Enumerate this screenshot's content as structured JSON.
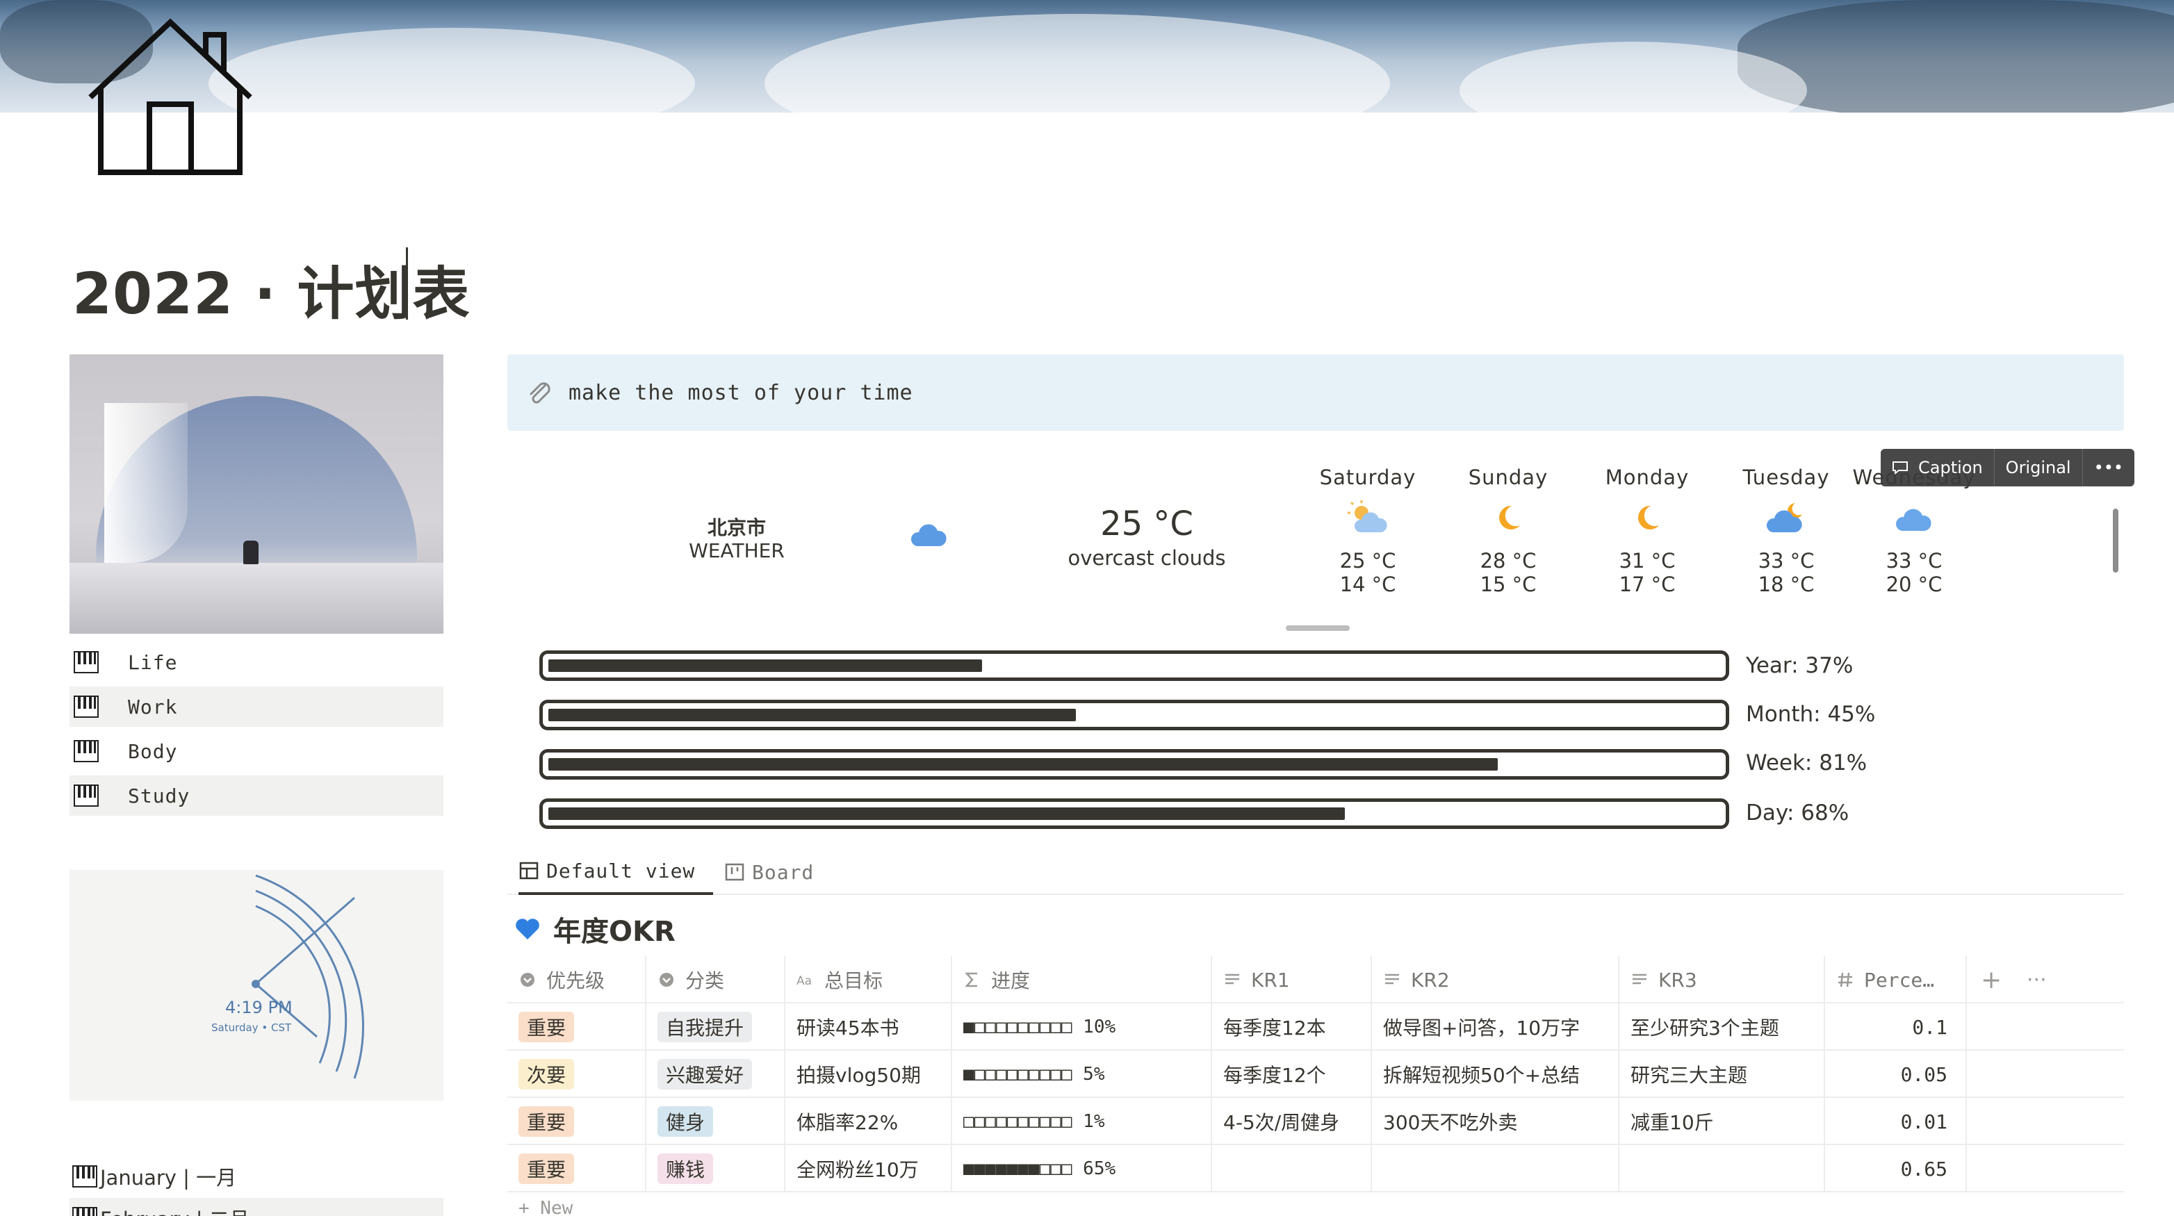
{
  "page": {
    "title": "2022 · 计划表"
  },
  "sidebar": {
    "items": [
      {
        "label": "Life"
      },
      {
        "label": "Work"
      },
      {
        "label": "Body"
      },
      {
        "label": "Study"
      }
    ],
    "clock": {
      "time": "4:19 PM",
      "date": "Saturday • CST"
    },
    "months": [
      {
        "label": "January | 一月"
      },
      {
        "label": "February | 二月"
      }
    ]
  },
  "quote": {
    "text": "make the most of your time"
  },
  "weather": {
    "city": "北京市",
    "label": "WEATHER",
    "current_temp": "25 °C",
    "current_desc": "overcast clouds",
    "forecast": [
      {
        "day": "Saturday",
        "high": "25 °C",
        "low": "14 °C",
        "icon": "sun-cloud-icon"
      },
      {
        "day": "Sunday",
        "high": "28 °C",
        "low": "15 °C",
        "icon": "moon-icon"
      },
      {
        "day": "Monday",
        "high": "31 °C",
        "low": "17 °C",
        "icon": "moon-icon"
      },
      {
        "day": "Tuesday",
        "high": "33 °C",
        "low": "18 °C",
        "icon": "cloud-moon-icon"
      },
      {
        "day": "Wednesday",
        "high": "33 °C",
        "low": "20 °C",
        "icon": "cloud-icon"
      }
    ]
  },
  "media_toolbar": {
    "caption": "Caption",
    "original": "Original",
    "more": "•••"
  },
  "progress": [
    {
      "label": "Year: 37%",
      "value": 0.37
    },
    {
      "label": "Month: 45%",
      "value": 0.45
    },
    {
      "label": "Week: 81%",
      "value": 0.81
    },
    {
      "label": "Day: 68%",
      "value": 0.68
    }
  ],
  "views": {
    "default": "Default view",
    "board": "Board"
  },
  "database": {
    "title": "年度OKR",
    "columns": [
      "优先级",
      "分类",
      "总目标",
      "进度",
      "KR1",
      "KR2",
      "KR3",
      "Perce…"
    ],
    "rows": [
      {
        "priority": "重要",
        "category": "自我提升",
        "goal": "研读45本书",
        "progress": "■□□□□□□□□□  10%",
        "kr1": "每季度12本",
        "kr2": "做导图+问答，10万字",
        "kr3": "至少研究3个主题",
        "percent": "0.1"
      },
      {
        "priority": "次要",
        "category": "兴趣爱好",
        "goal": "拍摄vlog50期",
        "progress": "■□□□□□□□□□  5%",
        "kr1": "每季度12个",
        "kr2": "拆解短视频50个+总结",
        "kr3": "研究三大主题",
        "percent": "0.05"
      },
      {
        "priority": "重要",
        "category": "健身",
        "goal": "体脂率22%",
        "progress": "□□□□□□□□□□  1%",
        "kr1": "4-5次/周健身",
        "kr2": "300天不吃外卖",
        "kr3": "减重10斤",
        "percent": "0.01"
      },
      {
        "priority": "重要",
        "category": "赚钱",
        "goal": "全网粉丝10万",
        "progress": "■■■■■■■□□□  65%",
        "kr1": "",
        "kr2": "",
        "kr3": "",
        "percent": "0.65"
      }
    ],
    "new_label": "+ New"
  },
  "colors": {
    "priority_important_bg": "#fadec9",
    "priority_secondary_bg": "#fbeecc",
    "tag_default_bg": "#ebeced",
    "tag_fitness_bg": "#d3e5ef",
    "tag_money_bg": "#f5e0e9",
    "callout_bg": "#e7f2f8",
    "text": "#37352f"
  }
}
